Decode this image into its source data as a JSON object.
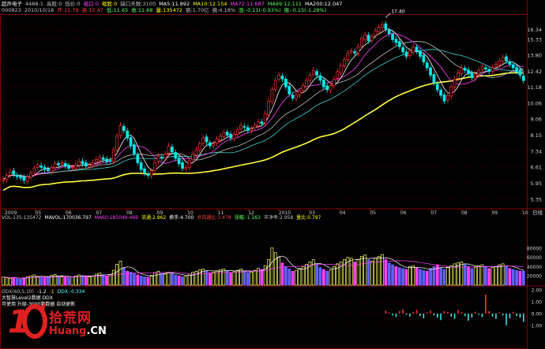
{
  "header": {
    "line1": [
      {
        "text": "超声电子",
        "color": "#ffffff"
      },
      {
        "text": "4488-1",
        "color": "#c0c0c0"
      },
      {
        "text": "高股:0",
        "color": "#c0c0c0"
      },
      {
        "text": "低价:0",
        "color": "#c0c0c0"
      },
      {
        "text": "缩口:0",
        "color": "#ff40ff"
      },
      {
        "text": "缩股:0",
        "color": "#ffff00"
      },
      {
        "text": "缺口天数:3100",
        "color": "#c0c0c0"
      },
      {
        "text": "MA5:11.892",
        "color": "#ffffff"
      },
      {
        "text": "MA10:12.154",
        "color": "#ffff00"
      },
      {
        "text": "MA72:11.687",
        "color": "#ff40ff"
      },
      {
        "text": "MA99:12.111",
        "color": "#60ff60"
      },
      {
        "text": "MA200:12.047",
        "color": "#ffffff"
      }
    ],
    "line2": [
      {
        "text": "000823",
        "color": "#c0c0c0"
      },
      {
        "text": "2010/10/18",
        "color": "#c0c0c0"
      },
      {
        "text": "开:11.79",
        "color": "#ff4040"
      },
      {
        "text": "高:12.47",
        "color": "#ff4040"
      },
      {
        "text": "低:11.65",
        "color": "#60ff60"
      },
      {
        "text": "收:11.68",
        "color": "#60ff60"
      },
      {
        "text": "量:135472",
        "color": "#ffff00"
      },
      {
        "text": "额:1.70亿",
        "color": "#c0c0c0"
      },
      {
        "text": "换:4.18%",
        "color": "#c0c0c0"
      },
      {
        "text": "涨:-0.11(-0.93%)",
        "color": "#60ff60"
      },
      {
        "text": "振:-0.15(-1.28%)",
        "color": "#60ff60"
      }
    ]
  },
  "volume_header": [
    {
      "text": "VOL-135:135472",
      "color": "#c0c0c0"
    },
    {
      "text": "MAVOL:170036.797",
      "color": "#ffffff"
    },
    {
      "text": "MA60:185049.469",
      "color": "#ff40ff"
    },
    {
      "text": "流通:2.862",
      "color": "#ffff00"
    },
    {
      "text": "换手:4.700",
      "color": "#ffffff"
    },
    {
      "text": "总流通比:1.478",
      "color": "#ff4040"
    },
    {
      "text": "涨幅:-1.163",
      "color": "#60ff60"
    },
    {
      "text": "市净率:2.958",
      "color": "#c0c0c0"
    },
    {
      "text": "量比:0.797",
      "color": "#ffff00"
    }
  ],
  "indicator_header": {
    "line1": [
      {
        "text": "DDX(60,5,10)",
        "color": "#c0c0c0"
      },
      {
        "text": "-1.2",
        "color": "#ffffff"
      },
      {
        "text": "-1",
        "color": "#ffff00"
      },
      {
        "text": "DDX:-0.334",
        "color": "#60ffff"
      }
    ],
    "line2": "大智慧Level2数据 DDX",
    "line3": "可使用 升级-3000套数据 自动更新"
  },
  "watermark": {
    "brand_cn": "拾荒网",
    "brand_en": "Huang",
    "brand_tld": ".CN"
  },
  "chart_data": {
    "type": "line",
    "title": "",
    "xlabel": "",
    "ylabel": "",
    "y_axis_label": "日线",
    "scale": "log",
    "x_tick_labels": [
      "2009",
      "05",
      "06",
      "07",
      "08",
      "09",
      "10",
      "11",
      "12",
      "2010",
      "03",
      "04",
      "05",
      "06",
      "07",
      "08",
      "09",
      "10"
    ],
    "y_ticks": [
      5.35,
      5.95,
      6.61,
      7.34,
      8.15,
      9.06,
      10.06,
      11.18,
      12.42,
      13.8,
      15.33,
      16.34
    ],
    "ylim": [
      5.1,
      17.9
    ],
    "volume_ticks": [
      20000,
      40000,
      60000,
      80000
    ],
    "volume_ylim": [
      0,
      100000
    ],
    "indicator_ticks": [
      -1.0,
      0.0,
      1.0,
      2.0
    ],
    "indicator_ylim": [
      -2.2,
      2.2
    ],
    "annotations": [
      {
        "label": "17.40",
        "x_index": 111,
        "value": 17.4
      }
    ],
    "colors": {
      "up": "#ff3030",
      "down": "#00e6e6",
      "ma_long": "#ffff40",
      "ma_mid": "#c0c0c0",
      "ma_short": "#ffffff",
      "ma_pink": "#ff40ff",
      "ma_cyan": "#40d0d0",
      "grid": "#4a0000"
    },
    "close": [
      6.1,
      6.25,
      6.4,
      6.3,
      6.2,
      6.15,
      6.05,
      6.2,
      6.35,
      6.55,
      6.7,
      6.6,
      6.5,
      6.45,
      6.6,
      6.75,
      6.7,
      6.8,
      6.65,
      6.55,
      6.6,
      6.7,
      6.85,
      6.75,
      6.65,
      6.7,
      6.8,
      6.95,
      7.05,
      6.95,
      6.85,
      6.9,
      7.4,
      8.1,
      8.7,
      8.4,
      8.0,
      7.6,
      7.2,
      6.8,
      6.5,
      6.35,
      6.25,
      6.45,
      6.8,
      7.1,
      7.0,
      7.2,
      7.6,
      7.3,
      7.0,
      6.75,
      6.55,
      6.6,
      6.9,
      7.2,
      7.4,
      7.7,
      8.0,
      7.8,
      7.6,
      7.7,
      7.95,
      8.1,
      8.3,
      8.15,
      8.0,
      8.2,
      8.45,
      8.7,
      8.6,
      8.4,
      8.5,
      8.7,
      8.9,
      8.8,
      9.4,
      10.2,
      11.0,
      11.7,
      12.1,
      11.8,
      11.2,
      10.7,
      10.4,
      10.6,
      10.9,
      11.3,
      11.7,
      12.1,
      12.5,
      12.1,
      11.7,
      11.2,
      11.0,
      11.3,
      11.8,
      12.4,
      12.9,
      13.4,
      14.0,
      14.2,
      14.0,
      14.6,
      15.4,
      15.8,
      15.2,
      15.6,
      16.2,
      16.6,
      16.9,
      16.4,
      15.9,
      15.3,
      15.0,
      14.6,
      14.1,
      13.7,
      14.2,
      14.6,
      14.2,
      13.7,
      13.2,
      12.7,
      12.1,
      11.5,
      11.0,
      10.6,
      10.2,
      10.6,
      11.2,
      11.8,
      12.3,
      12.7,
      12.5,
      12.2,
      11.9,
      12.2,
      12.5,
      12.8,
      12.6,
      12.4,
      12.7,
      13.0,
      13.3,
      13.6,
      13.3,
      13.0,
      12.7,
      12.4,
      12.1,
      11.68
    ],
    "volume": [
      18000,
      16000,
      15000,
      17000,
      14000,
      13000,
      16000,
      18000,
      20000,
      22000,
      19000,
      17000,
      16000,
      18000,
      21000,
      23000,
      20000,
      19000,
      17000,
      16000,
      18000,
      20000,
      22000,
      21000,
      19000,
      18000,
      20000,
      24000,
      26000,
      22000,
      20000,
      23000,
      32000,
      45000,
      52000,
      38000,
      30000,
      28000,
      25000,
      22000,
      20000,
      18000,
      17000,
      21000,
      27000,
      30000,
      25000,
      24000,
      28000,
      26000,
      22000,
      20000,
      18000,
      19000,
      24000,
      28000,
      30000,
      33000,
      35000,
      30000,
      27000,
      28000,
      31000,
      33000,
      35000,
      30000,
      27000,
      29000,
      32000,
      35000,
      30000,
      27000,
      28000,
      32000,
      36000,
      34000,
      42000,
      55000,
      80000,
      70000,
      60000,
      48000,
      40000,
      35000,
      30000,
      32000,
      36000,
      40000,
      45000,
      50000,
      55000,
      45000,
      38000,
      34000,
      30000,
      33000,
      40000,
      46000,
      50000,
      55000,
      60000,
      58000,
      50000,
      55000,
      62000,
      65000,
      55000,
      52000,
      58000,
      62000,
      66000,
      55000,
      48000,
      44000,
      40000,
      38000,
      36000,
      34000,
      40000,
      42000,
      38000,
      34000,
      32000,
      30000,
      36000,
      40000,
      44000,
      38000,
      34000,
      38000,
      42000,
      46000,
      48000,
      50000,
      44000,
      40000,
      36000,
      38000,
      42000,
      44000,
      40000,
      36000,
      38000,
      40000,
      44000,
      46000,
      40000,
      36000,
      34000,
      32000,
      30000,
      31000
    ],
    "ddx": [
      0.25,
      0.1,
      -0.15,
      -0.3,
      0.2,
      0.35,
      -0.1,
      -0.25,
      0.15,
      0.3,
      -0.2,
      -0.4,
      0.1,
      0.25,
      -0.15,
      -0.35,
      -0.55,
      0.2,
      0.15,
      -0.25,
      -0.45,
      0.3,
      0.1,
      -0.2,
      -0.6,
      -0.35,
      0.15,
      -0.1,
      -0.3,
      1.6,
      0.2,
      -0.25,
      -0.45,
      0.1,
      -0.15,
      -1.0,
      -0.4,
      0.15,
      -0.2,
      -0.35,
      -0.7
    ]
  }
}
